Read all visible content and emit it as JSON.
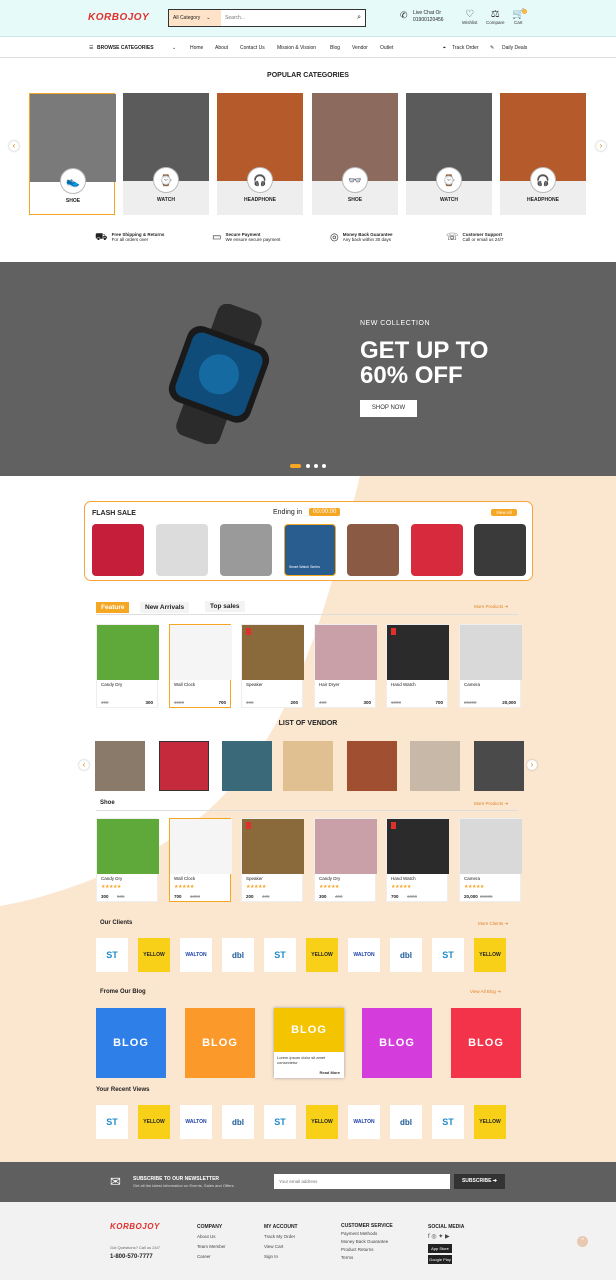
{
  "header": {
    "logo": "KORBOJOY",
    "category_select": "All Category",
    "search_placeholder": "Search...",
    "phone_label": "Live Chat Or",
    "phone_number": "01900120456",
    "wishlist_label": "Wishlist",
    "compare_label": "Compare",
    "cart_label": "Cart",
    "cart_count": "0"
  },
  "nav": {
    "browse": "BROWSE CATEGORIES",
    "items": [
      "Home",
      "About",
      "Contact Us",
      "Mission & Vission",
      "Blog",
      "Vendor",
      "Outlet"
    ],
    "track_order": "Track Order",
    "daily_deals": "Daily Deals"
  },
  "popular": {
    "title": "POPULAR CATEGORIES",
    "items": [
      {
        "label": "SHOE",
        "color": "#7a7a7a",
        "icon": "shoe-icon"
      },
      {
        "label": "WATCH",
        "color": "#5b5b5b",
        "icon": "watch-icon"
      },
      {
        "label": "HEADPHONE",
        "color": "#b55a2a",
        "icon": "headphone-icon"
      },
      {
        "label": "SHOE",
        "color": "#8d6a5e",
        "icon": "glasses-icon"
      },
      {
        "label": "WATCH",
        "color": "#5b5b5b",
        "icon": "watch-icon"
      },
      {
        "label": "HEADPHONE",
        "color": "#b55a2a",
        "icon": "headphone-icon"
      }
    ]
  },
  "features": [
    {
      "title": "Free Shipping & Returns",
      "sub": "For all orders over"
    },
    {
      "title": "Secure Payment",
      "sub": "We ensure secure payment"
    },
    {
      "title": "Money Back Guarantee",
      "sub": "Any back within 30 days"
    },
    {
      "title": "Customer Support",
      "sub": "Call or email us 24/7"
    }
  ],
  "hero": {
    "kicker": "NEW COLLECTION",
    "headline_1": "GET UP TO",
    "headline_2": "60% OFF",
    "button": "SHOP NOW"
  },
  "flash": {
    "title": "FLASH SALE",
    "ending_label": "Ending in",
    "timer": "00:00:00",
    "view_all": "View All",
    "item_label": "Smart Watch Series",
    "items": [
      "#c41e3a",
      "#dcdcdc",
      "#9a9a9a",
      "#2a5d8f",
      "#8a5a44",
      "#d72a3c",
      "#3a3a3a"
    ]
  },
  "tabs": {
    "feature": "Feature",
    "new_arrivals": "New Arrivals",
    "top_sales": "Top sales",
    "more": "More Products"
  },
  "products": [
    {
      "name": "Candy Dry",
      "old": "400",
      "price": "300",
      "color": "#5fa83a"
    },
    {
      "name": "Wall Clock",
      "old": "1000",
      "price": "700",
      "color": "#f5f5f5"
    },
    {
      "name": "Speaker",
      "old": "400",
      "price": "200",
      "color": "#8a6a3a"
    },
    {
      "name": "Hair Dryer",
      "old": "400",
      "price": "300",
      "color": "#c9a0a8"
    },
    {
      "name": "Hand Watch",
      "old": "1000",
      "price": "700",
      "color": "#2b2b2b"
    },
    {
      "name": "Camera",
      "old": "25000",
      "price": "20,000",
      "color": "#d9d9d9"
    }
  ],
  "vendor": {
    "title": "LIST OF VENDOR",
    "items": [
      "#8a7a6a",
      "#c42a3c",
      "#3a6a7a",
      "#e0c090",
      "#a05030",
      "#c8b8a8",
      "#4a4a4a"
    ]
  },
  "shoe": {
    "title": "Shoe",
    "more": "More Products",
    "products": [
      {
        "name": "Candy Dry",
        "price": "300",
        "old": "500"
      },
      {
        "name": "Wall Clock",
        "price": "700",
        "old": "1000"
      },
      {
        "name": "Speaker",
        "price": "200",
        "old": "400"
      },
      {
        "name": "Candy Dry",
        "price": "300",
        "old": "400"
      },
      {
        "name": "Hand Watch",
        "price": "700",
        "old": "1000"
      },
      {
        "name": "Camera",
        "price": "20,000",
        "old": "25000"
      }
    ]
  },
  "clients": {
    "title": "Our Clients",
    "more": "More Clients",
    "logos": [
      "ST",
      "YELLOW",
      "WALTON",
      "dbl",
      "ST",
      "YELLOW",
      "WALTON",
      "dbl",
      "ST",
      "YELLOW"
    ]
  },
  "blog": {
    "title": "Frome Our Blog",
    "more": "View All Blog",
    "card_label": "BLOG",
    "caption": "Lorem ipsum dolor sit amet consectetur",
    "read_more": "Read More",
    "colors": [
      "#2f7fe8",
      "#fb9a2a",
      "#f5c400",
      "#d43cdc",
      "#f2334a"
    ]
  },
  "recent": {
    "title": "Your Recent Views",
    "logos": [
      "ST",
      "YELLOW",
      "WALTON",
      "dbl",
      "ST",
      "YELLOW",
      "WALTON",
      "dbl",
      "ST",
      "YELLOW"
    ]
  },
  "newsletter": {
    "title": "SUBSCRIBE TO OUR NEWSLETTER",
    "sub": "Get all the latest information on Events, Sales and Offers.",
    "placeholder": "Your email address",
    "button": "SUBSCRIBE"
  },
  "footer": {
    "logo": "KORBOJOY",
    "address": "Got Questions? Call us 24/7",
    "phone": "1-800-570-7777",
    "company": {
      "title": "COMPANY",
      "links": [
        "About Us",
        "Team Member",
        "Career"
      ]
    },
    "account": {
      "title": "MY ACCOUNT",
      "links": [
        "Track My Order",
        "View Cart",
        "Sign In"
      ]
    },
    "service": {
      "title": "CUSTOMER SERVICE",
      "links": [
        "Payment Methods",
        "Money Back Guarantee",
        "Product Returns",
        "Terms"
      ]
    },
    "social": {
      "title": "SOCIAL MEDIA",
      "appstore": "App Store",
      "playstore": "Google Play"
    }
  }
}
